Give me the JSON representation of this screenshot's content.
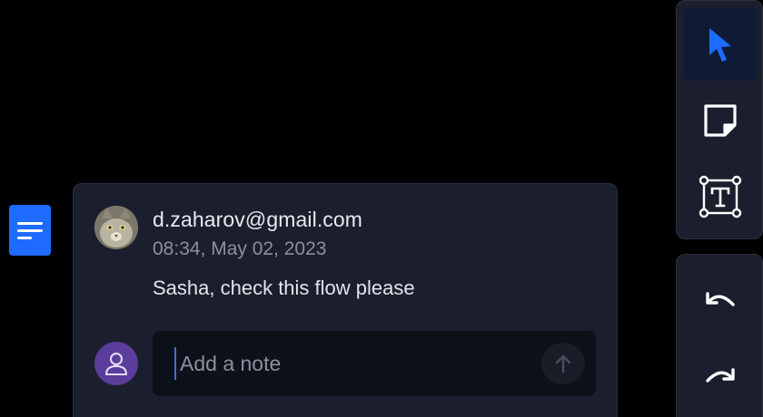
{
  "comment": {
    "author": "d.zaharov@gmail.com",
    "timestamp": "08:34, May 02, 2023",
    "message": "Sasha, check this flow please",
    "reply": {
      "value": "",
      "placeholder": "Add a note"
    }
  },
  "pin": {
    "icon": "comment-lines-icon",
    "color": "#1e6bff"
  },
  "toolbar": {
    "tools": [
      {
        "icon": "cursor-icon",
        "active": true
      },
      {
        "icon": "sticky-note-icon",
        "active": false
      },
      {
        "icon": "text-frame-icon",
        "active": false
      }
    ],
    "history": [
      {
        "icon": "undo-icon"
      },
      {
        "icon": "redo-icon"
      }
    ]
  },
  "colors": {
    "accent": "#1e6bff",
    "panel": "#1b1e2c",
    "user_avatar": "#5b3d9c"
  }
}
